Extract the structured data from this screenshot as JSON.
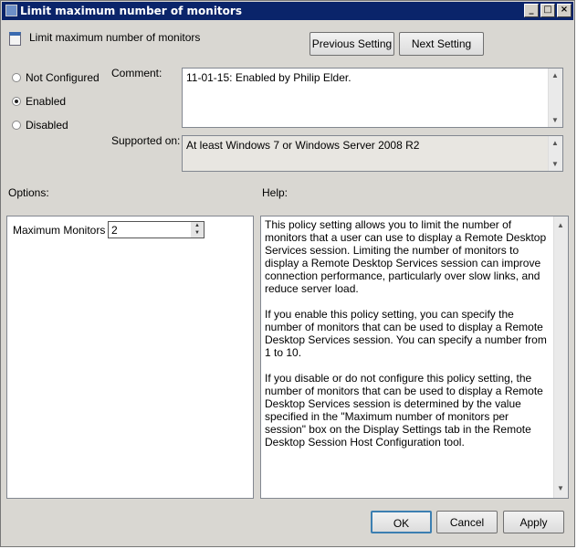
{
  "window": {
    "title": "Limit maximum number of monitors"
  },
  "header": {
    "setting_name": "Limit maximum number of monitors",
    "previous_label": "Previous Setting",
    "next_label": "Next Setting"
  },
  "state": {
    "options": [
      "Not Configured",
      "Enabled",
      "Disabled"
    ],
    "selected": "Enabled"
  },
  "comment": {
    "label": "Comment:",
    "value": "11-01-15: Enabled by Philip Elder."
  },
  "supported": {
    "label": "Supported on:",
    "value": "At least Windows 7 or Windows Server 2008 R2"
  },
  "options_panel": {
    "label": "Options:",
    "field_label": "Maximum Monitors",
    "field_value": "2"
  },
  "help_panel": {
    "label": "Help:",
    "paragraphs": [
      "This policy setting allows you to limit the number of monitors that a user can use to display a Remote Desktop Services session. Limiting the number of monitors to display a Remote Desktop Services session can improve connection performance, particularly over slow links, and reduce server load.",
      "If you enable this policy setting, you can specify the number of monitors that can be used to display a Remote Desktop Services session. You can specify a number from 1 to 10.",
      "If you disable or do not configure this policy setting, the number of monitors that can be used to display a Remote Desktop Services session is determined by the value specified in the \"Maximum number of monitors per session\" box on the Display Settings tab in the Remote Desktop Session Host Configuration tool."
    ]
  },
  "footer": {
    "ok": "OK",
    "cancel": "Cancel",
    "apply": "Apply"
  }
}
